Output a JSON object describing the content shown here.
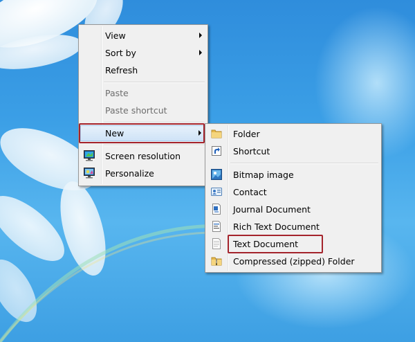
{
  "context_menu": {
    "items": [
      {
        "label": "View",
        "has_submenu": true,
        "enabled": true
      },
      {
        "label": "Sort by",
        "has_submenu": true,
        "enabled": true
      },
      {
        "label": "Refresh",
        "has_submenu": false,
        "enabled": true
      },
      {
        "label": "Paste",
        "has_submenu": false,
        "enabled": false
      },
      {
        "label": "Paste shortcut",
        "has_submenu": false,
        "enabled": false
      },
      {
        "label": "New",
        "has_submenu": true,
        "enabled": true,
        "highlighted": true
      },
      {
        "label": "Screen resolution",
        "icon": "monitor-icon",
        "has_submenu": false,
        "enabled": true
      },
      {
        "label": "Personalize",
        "icon": "personalize-icon",
        "has_submenu": false,
        "enabled": true
      }
    ]
  },
  "new_submenu": {
    "items": [
      {
        "label": "Folder",
        "icon": "folder-icon"
      },
      {
        "label": "Shortcut",
        "icon": "shortcut-icon"
      },
      {
        "label": "Bitmap image",
        "icon": "bitmap-icon"
      },
      {
        "label": "Contact",
        "icon": "contact-icon"
      },
      {
        "label": "Journal Document",
        "icon": "journal-icon"
      },
      {
        "label": "Rich Text Document",
        "icon": "rich-text-icon"
      },
      {
        "label": "Text Document",
        "icon": "text-document-icon",
        "highlighted": true
      },
      {
        "label": "Compressed (zipped) Folder",
        "icon": "zip-folder-icon"
      }
    ]
  },
  "colors": {
    "highlight_border": "#a4232b",
    "menu_background": "#f0f0f0",
    "desktop_blue": "#3b9fe6"
  }
}
